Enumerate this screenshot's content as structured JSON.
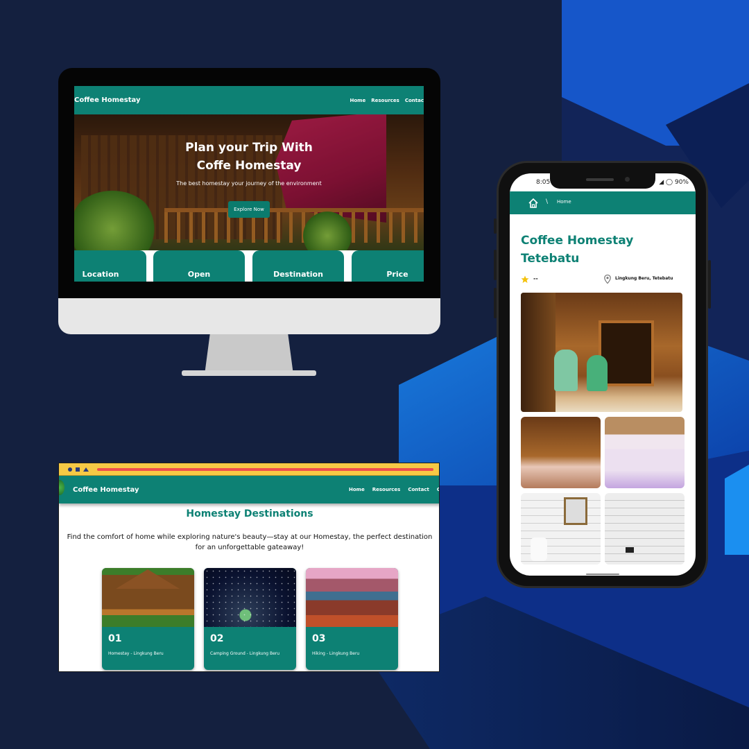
{
  "colors": {
    "brand_teal": "#0d8174",
    "background_navy": "#14203f",
    "accent_blue": "#1b62d6",
    "browser_bar": "#f6c945"
  },
  "desktop": {
    "brand": "Coffee Homestay",
    "nav": [
      "Home",
      "Resources",
      "Contac"
    ],
    "hero_title_line1": "Plan your Trip With",
    "hero_title_line2": "Coffe Homestay",
    "hero_subtitle": "The best homestay your journey of the environment",
    "cta_label": "Explore Now",
    "info_cards": [
      "Location",
      "Open",
      "Destination",
      "Price"
    ]
  },
  "browser": {
    "brand": "Coffee Homestay",
    "nav": [
      "Home",
      "Resources",
      "Contact",
      "C"
    ],
    "heading": "Homestay Destinations",
    "description": "Find the comfort of home while exploring nature's beauty—stay at our Homestay, the perfect destination for an unforgettable gateaway!",
    "cards": [
      {
        "number": "01",
        "caption": "Homestay - Lingkung Beru"
      },
      {
        "number": "02",
        "caption": "Camping Ground - Lingkung Beru"
      },
      {
        "number": "03",
        "caption": "Hiking - Lingkung Beru"
      }
    ]
  },
  "phone": {
    "time": "8:05",
    "battery": "90%",
    "breadcrumb_separator": "\\",
    "breadcrumb": "Home",
    "title": "Coffee Homestay Tetebatu",
    "rating": "--",
    "location": "Lingkung Beru, Tetebatu"
  }
}
